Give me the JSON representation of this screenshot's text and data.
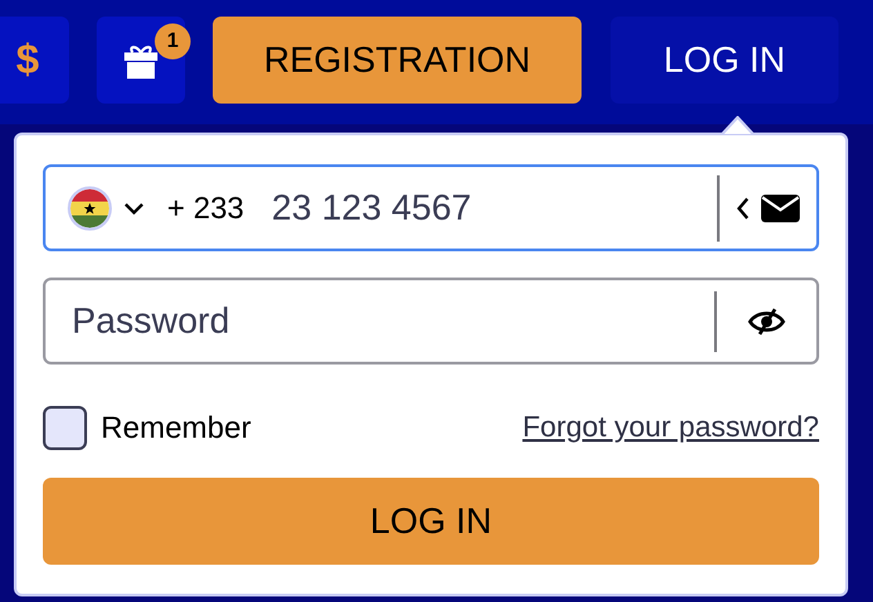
{
  "header": {
    "currency_symbol": "$",
    "gift_badge": "1",
    "buttons": [
      {
        "label": "REGISTRATION",
        "kind": "primary"
      },
      {
        "label": "LOG IN",
        "kind": "secondary"
      }
    ]
  },
  "login_form": {
    "phone": {
      "country_code": "+ 233",
      "placeholder": "23 123 4567"
    },
    "password": {
      "placeholder": "Password"
    },
    "remember": {
      "label": "Remember",
      "checked": false
    },
    "forgot_link": "Forgot your password?",
    "submit": "LOG IN"
  }
}
